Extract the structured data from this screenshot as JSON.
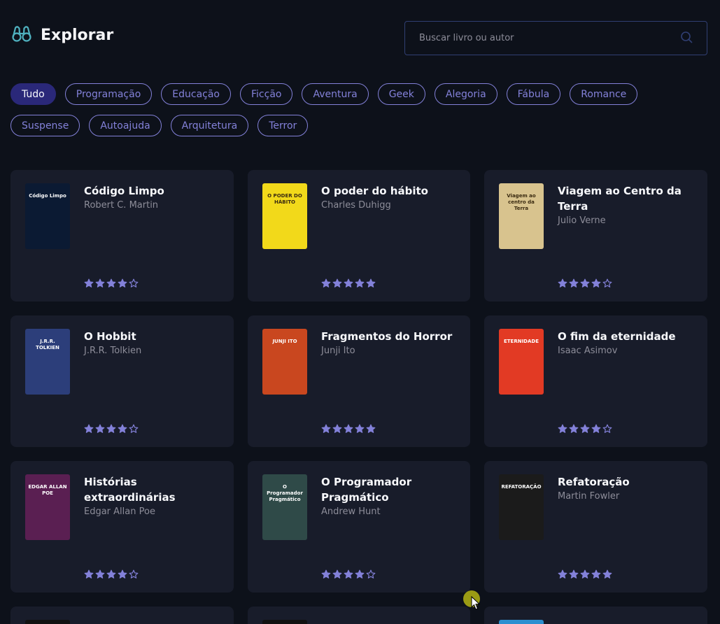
{
  "header": {
    "title": "Explorar",
    "search_placeholder": "Buscar livro ou autor"
  },
  "tags": [
    {
      "label": "Tudo",
      "active": true
    },
    {
      "label": "Programação",
      "active": false
    },
    {
      "label": "Educação",
      "active": false
    },
    {
      "label": "Ficção",
      "active": false
    },
    {
      "label": "Aventura",
      "active": false
    },
    {
      "label": "Geek",
      "active": false
    },
    {
      "label": "Alegoria",
      "active": false
    },
    {
      "label": "Fábula",
      "active": false
    },
    {
      "label": "Romance",
      "active": false
    },
    {
      "label": "Suspense",
      "active": false
    },
    {
      "label": "Autoajuda",
      "active": false
    },
    {
      "label": "Arquitetura",
      "active": false
    },
    {
      "label": "Terror",
      "active": false
    }
  ],
  "books": [
    {
      "title": "Código Limpo",
      "author": "Robert C. Martin",
      "rating": 4,
      "cover_color": "#0b1a33",
      "cover_text": "Código Limpo"
    },
    {
      "title": "O poder do hábito",
      "author": "Charles Duhigg",
      "rating": 5,
      "cover_color": "#f2d91a",
      "cover_text": "O PODER DO HÁBITO"
    },
    {
      "title": "Viagem ao Centro da Terra",
      "author": "Julio Verne",
      "rating": 4,
      "cover_color": "#d8c38e",
      "cover_text": "Viagem ao centro da Terra"
    },
    {
      "title": "O Hobbit",
      "author": "J.R.R. Tolkien",
      "rating": 4,
      "cover_color": "#2c3e7a",
      "cover_text": "J.R.R. TOLKIEN"
    },
    {
      "title": "Fragmentos do Horror",
      "author": "Junji Ito",
      "rating": 5,
      "cover_color": "#c9471f",
      "cover_text": "JUNJI ITO"
    },
    {
      "title": "O fim da eternidade",
      "author": "Isaac Asimov",
      "rating": 4,
      "cover_color": "#e23a24",
      "cover_text": "ETERNIDADE"
    },
    {
      "title": "Histórias extraordinárias",
      "author": "Edgar Allan Poe",
      "rating": 4,
      "cover_color": "#5a1f52",
      "cover_text": "EDGAR ALLAN POE"
    },
    {
      "title": "O Programador Pragmático",
      "author": "Andrew Hunt",
      "rating": 4,
      "cover_color": "#2f4a48",
      "cover_text": "O Programador Pragmático"
    },
    {
      "title": "Refatoração",
      "author": "Martin Fowler",
      "rating": 5,
      "cover_color": "#1b1b1b",
      "cover_text": "REFATORAÇÃO"
    }
  ],
  "colors": {
    "accent": "#8381d9",
    "active_tag": "#2a2879",
    "card_bg": "#181c2a",
    "page_bg": "#0d111a",
    "star": "#8381d9"
  }
}
